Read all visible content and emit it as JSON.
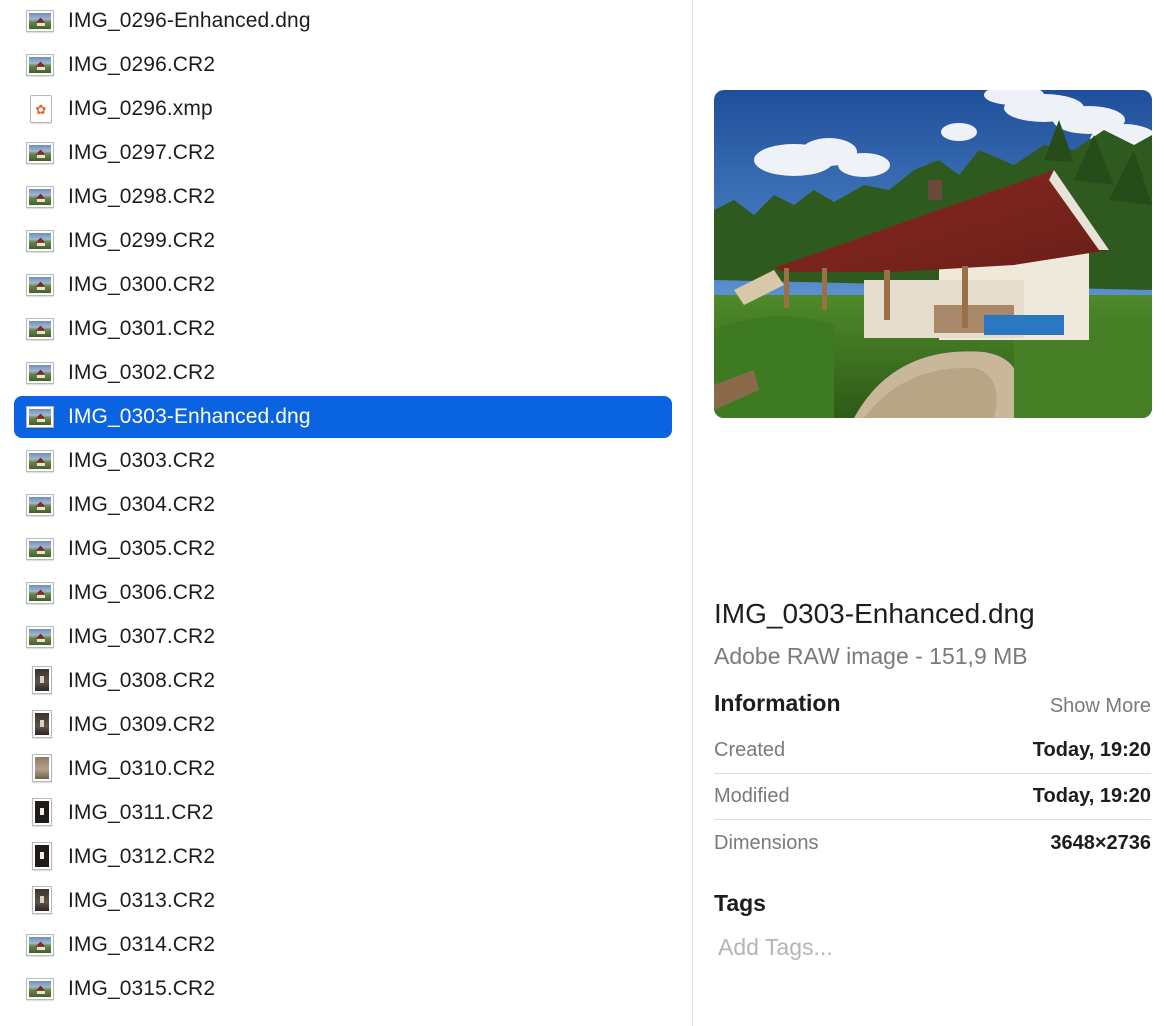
{
  "files": [
    {
      "name": "IMG_0296-Enhanced.dng",
      "icon": "image-thumbnail-icon",
      "kind": "landscape"
    },
    {
      "name": "IMG_0296.CR2",
      "icon": "image-thumbnail-icon",
      "kind": "landscape"
    },
    {
      "name": "IMG_0296.xmp",
      "icon": "xmp-file-icon",
      "kind": "xmp"
    },
    {
      "name": "IMG_0297.CR2",
      "icon": "image-thumbnail-icon",
      "kind": "landscape"
    },
    {
      "name": "IMG_0298.CR2",
      "icon": "image-thumbnail-icon",
      "kind": "landscape"
    },
    {
      "name": "IMG_0299.CR2",
      "icon": "image-thumbnail-icon",
      "kind": "landscape"
    },
    {
      "name": "IMG_0300.CR2",
      "icon": "image-thumbnail-icon",
      "kind": "landscape"
    },
    {
      "name": "IMG_0301.CR2",
      "icon": "image-thumbnail-icon",
      "kind": "landscape"
    },
    {
      "name": "IMG_0302.CR2",
      "icon": "image-thumbnail-icon",
      "kind": "landscape"
    },
    {
      "name": "IMG_0303-Enhanced.dng",
      "icon": "image-thumbnail-icon",
      "kind": "landscape",
      "selected": true
    },
    {
      "name": "IMG_0303.CR2",
      "icon": "image-thumbnail-icon",
      "kind": "landscape"
    },
    {
      "name": "IMG_0304.CR2",
      "icon": "image-thumbnail-icon",
      "kind": "landscape"
    },
    {
      "name": "IMG_0305.CR2",
      "icon": "image-thumbnail-icon",
      "kind": "landscape"
    },
    {
      "name": "IMG_0306.CR2",
      "icon": "image-thumbnail-icon",
      "kind": "landscape"
    },
    {
      "name": "IMG_0307.CR2",
      "icon": "image-thumbnail-icon",
      "kind": "landscape"
    },
    {
      "name": "IMG_0308.CR2",
      "icon": "image-thumbnail-icon",
      "kind": "dark"
    },
    {
      "name": "IMG_0309.CR2",
      "icon": "image-thumbnail-icon",
      "kind": "dark"
    },
    {
      "name": "IMG_0310.CR2",
      "icon": "image-thumbnail-icon",
      "kind": "warm"
    },
    {
      "name": "IMG_0311.CR2",
      "icon": "image-thumbnail-icon",
      "kind": "darker"
    },
    {
      "name": "IMG_0312.CR2",
      "icon": "image-thumbnail-icon",
      "kind": "darker"
    },
    {
      "name": "IMG_0313.CR2",
      "icon": "image-thumbnail-icon",
      "kind": "dark"
    },
    {
      "name": "IMG_0314.CR2",
      "icon": "image-thumbnail-icon",
      "kind": "landscape"
    },
    {
      "name": "IMG_0315.CR2",
      "icon": "image-thumbnail-icon",
      "kind": "landscape"
    }
  ],
  "preview": {
    "file_name": "IMG_0303-Enhanced.dng",
    "kind_size": "Adobe RAW image - 151,9 MB",
    "information_title": "Information",
    "show_more_label": "Show More",
    "info": [
      {
        "label": "Created",
        "value": "Today, 19:20"
      },
      {
        "label": "Modified",
        "value": "Today, 19:20"
      },
      {
        "label": "Dimensions",
        "value": "3648×2736"
      }
    ],
    "tags_title": "Tags",
    "add_tags_placeholder": "Add Tags..."
  },
  "colors": {
    "selection": "#0a63e0",
    "secondary_text": "#7a7a7a"
  }
}
